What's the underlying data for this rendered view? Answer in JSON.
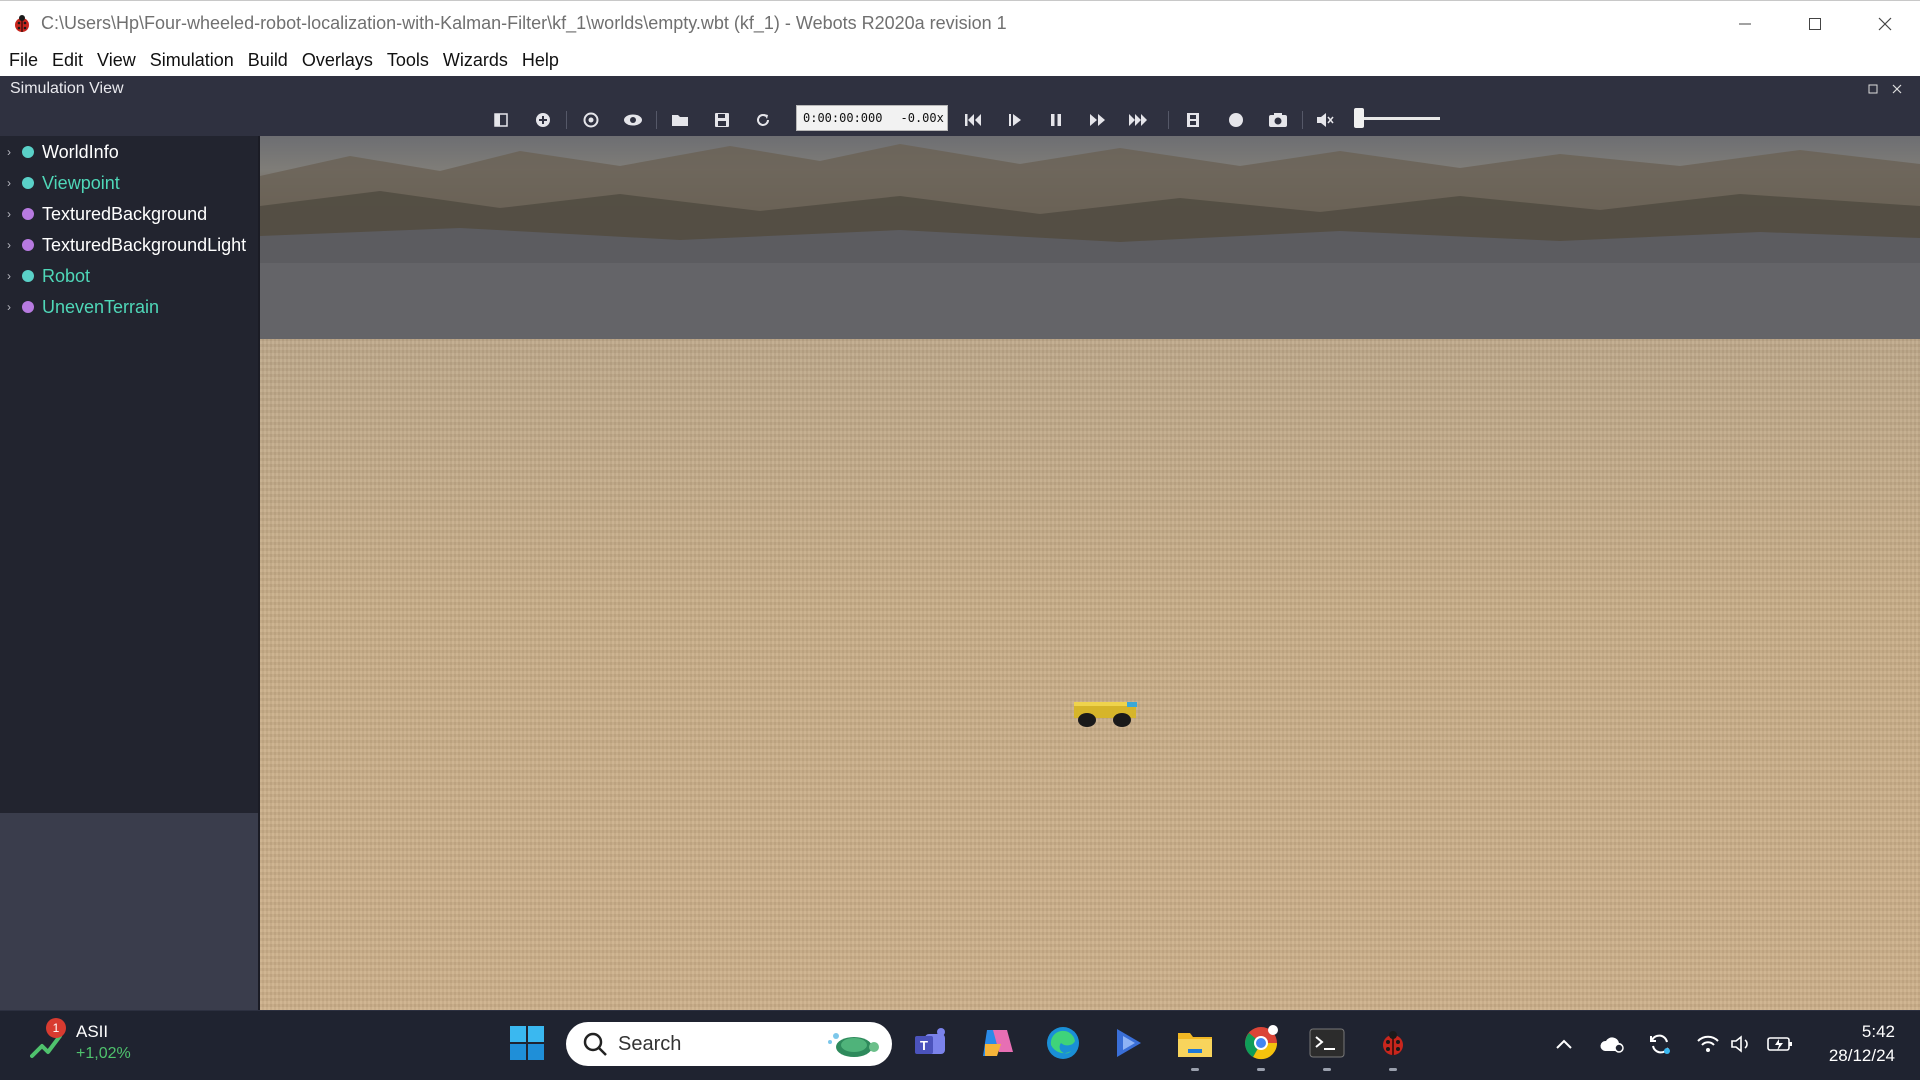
{
  "window": {
    "title": "C:\\Users\\Hp\\Four-wheeled-robot-localization-with-Kalman-Filter\\kf_1\\worlds\\empty.wbt (kf_1) - Webots R2020a revision 1"
  },
  "menu": {
    "items": [
      "File",
      "Edit",
      "View",
      "Simulation",
      "Build",
      "Overlays",
      "Tools",
      "Wizards",
      "Help"
    ]
  },
  "simulation_view": {
    "title": "Simulation View",
    "time": "0:00:00:000",
    "dash": "-",
    "speed": "0.00x"
  },
  "scene_tree": {
    "items": [
      {
        "label": "WorldInfo",
        "dot_color": "#5ad1c8",
        "text_color": "#ffffff"
      },
      {
        "label": "Viewpoint",
        "dot_color": "#5ad1c8",
        "text_color": "#4fd7b8"
      },
      {
        "label": "TexturedBackground",
        "dot_color": "#b77ae0",
        "text_color": "#ffffff"
      },
      {
        "label": "TexturedBackgroundLight",
        "dot_color": "#b77ae0",
        "text_color": "#ffffff"
      },
      {
        "label": "Robot",
        "dot_color": "#5ad1c8",
        "text_color": "#4fd7b8"
      },
      {
        "label": "UnevenTerrain",
        "dot_color": "#b77ae0",
        "text_color": "#4fd7b8"
      }
    ]
  },
  "taskbar": {
    "stock_name": "ASII",
    "stock_change": "+1,02%",
    "stock_badge": "1",
    "search_label": "Search",
    "time": "5:42",
    "date": "28/12/24"
  },
  "colors": {
    "accent_teal": "#4fd7b8",
    "node_purple": "#b77ae0",
    "panel_bg": "#22242f",
    "toolbar_bg": "#2f3140"
  }
}
